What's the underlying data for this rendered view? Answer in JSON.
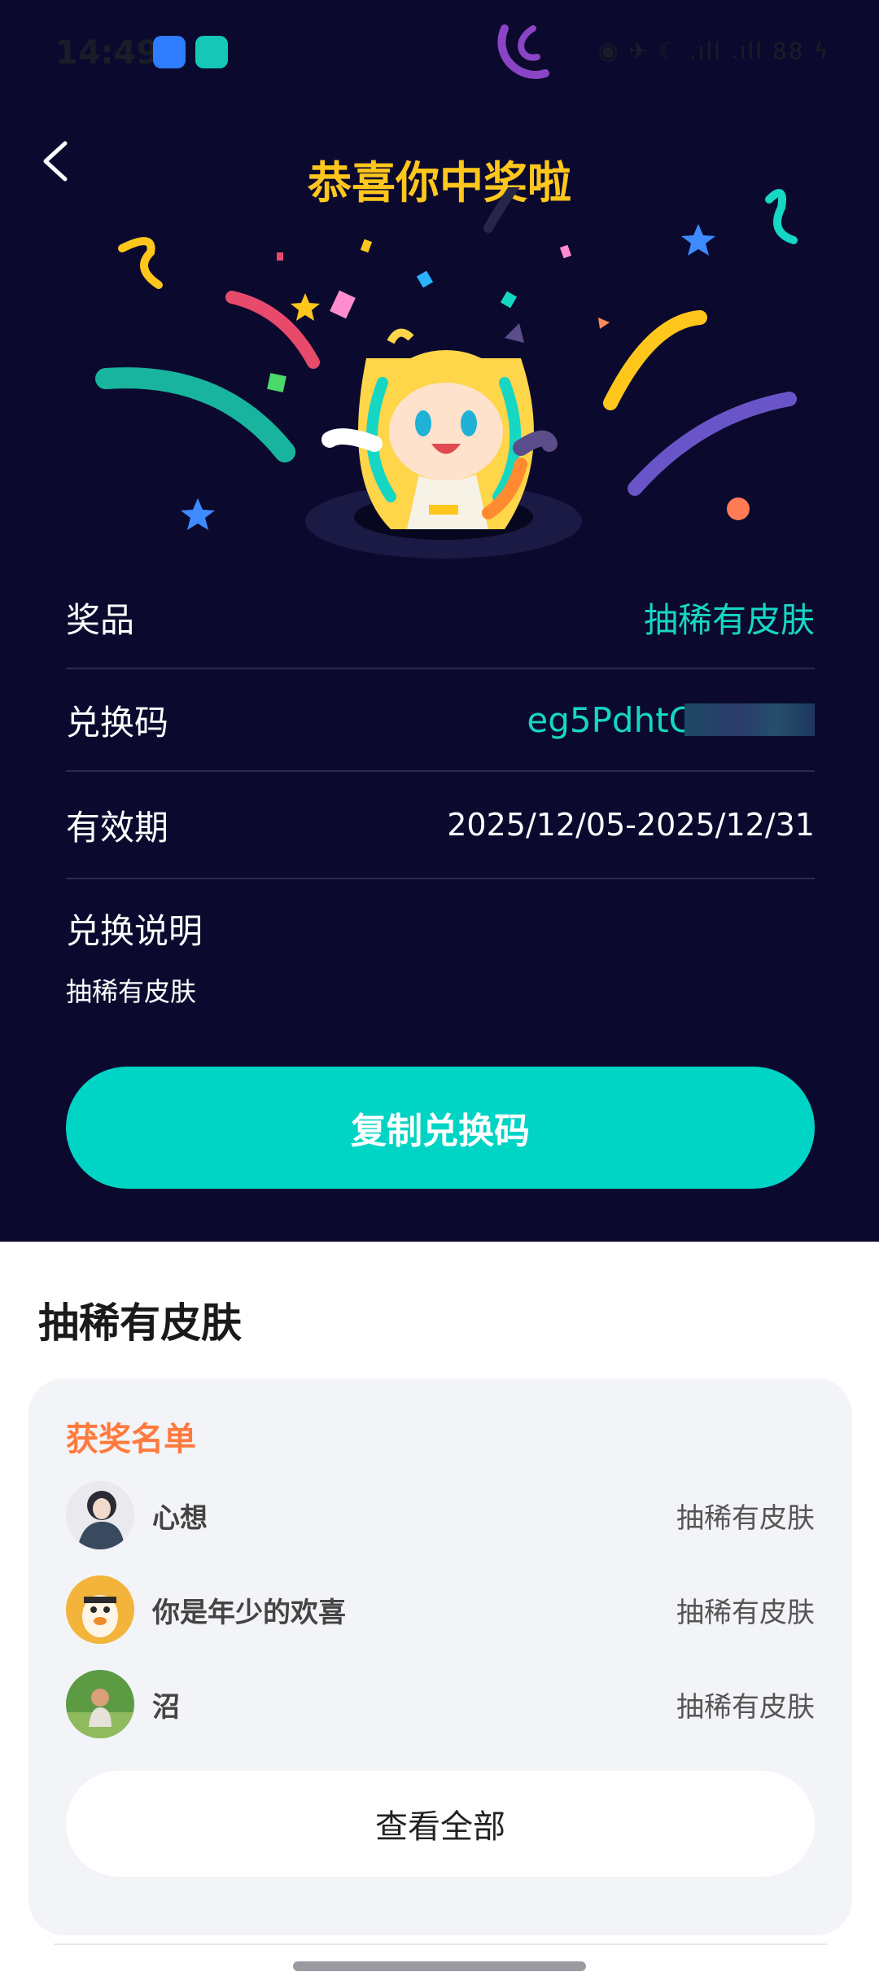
{
  "status_bar": {
    "time": "14:49",
    "right_text": "◉ ✈ ☾ .ıll .ıll 88 ϟ"
  },
  "header": {
    "title": "恭喜你中奖啦"
  },
  "info": {
    "prize_label": "奖品",
    "prize_value": "抽稀有皮肤",
    "code_label": "兑换码",
    "code_value": "eg5PdhtC",
    "validity_label": "有效期",
    "validity_value": "2025/12/05-2025/12/31",
    "desc_label": "兑换说明",
    "desc_text": "抽稀有皮肤"
  },
  "copy_button": {
    "label": "复制兑换码"
  },
  "lower": {
    "section_title": "抽稀有皮肤",
    "winners_heading": "获奖名单",
    "winners": [
      {
        "name": "心想",
        "prize": "抽稀有皮肤"
      },
      {
        "name": "你是年少的欢喜",
        "prize": "抽稀有皮肤"
      },
      {
        "name": "沼",
        "prize": "抽稀有皮肤"
      }
    ],
    "view_all_label": "查看全部"
  },
  "colors": {
    "dark_bg": "#0b0a2e",
    "title_yellow": "#ffc61c",
    "accent_teal": "#00d4c4",
    "winners_heading_orange": "#ff7a3d"
  }
}
